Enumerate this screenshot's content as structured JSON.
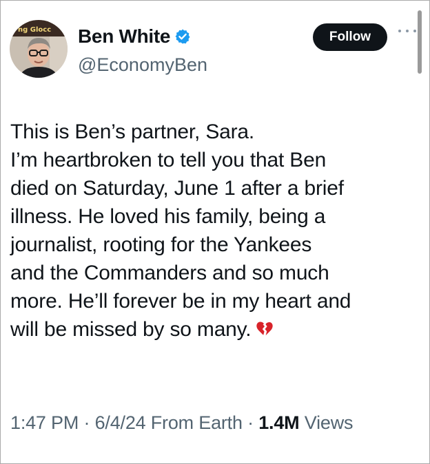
{
  "author": {
    "display_name": "Ben White",
    "handle": "@EconomyBen",
    "verified_icon": "verified-badge-icon",
    "avatar_sign_text": "ng Glocc"
  },
  "actions": {
    "follow_label": "Follow",
    "more_icon": "more-horizontal-icon"
  },
  "tweet": {
    "lines": [
      "This is Ben’s partner, Sara.",
      "I’m heartbroken to tell you that Ben",
      "died on Saturday, June 1 after a brief",
      "illness. He loved his family, being a",
      "journalist, rooting for the Yankees",
      "and the Commanders and so much",
      "more. He’ll forever be in my heart and",
      "will be missed by so many."
    ],
    "emoji_icon": "broken-heart-icon"
  },
  "meta": {
    "time": "1:47 PM",
    "date": "6/4/24",
    "source": "From Earth",
    "views_count": "1.4M",
    "views_label": "Views",
    "separator": "·"
  },
  "colors": {
    "text_primary": "#0f1419",
    "text_secondary": "#536471",
    "verified_blue": "#1d9bf0",
    "follow_bg": "#0f1419",
    "broken_heart": "#d8232a"
  }
}
